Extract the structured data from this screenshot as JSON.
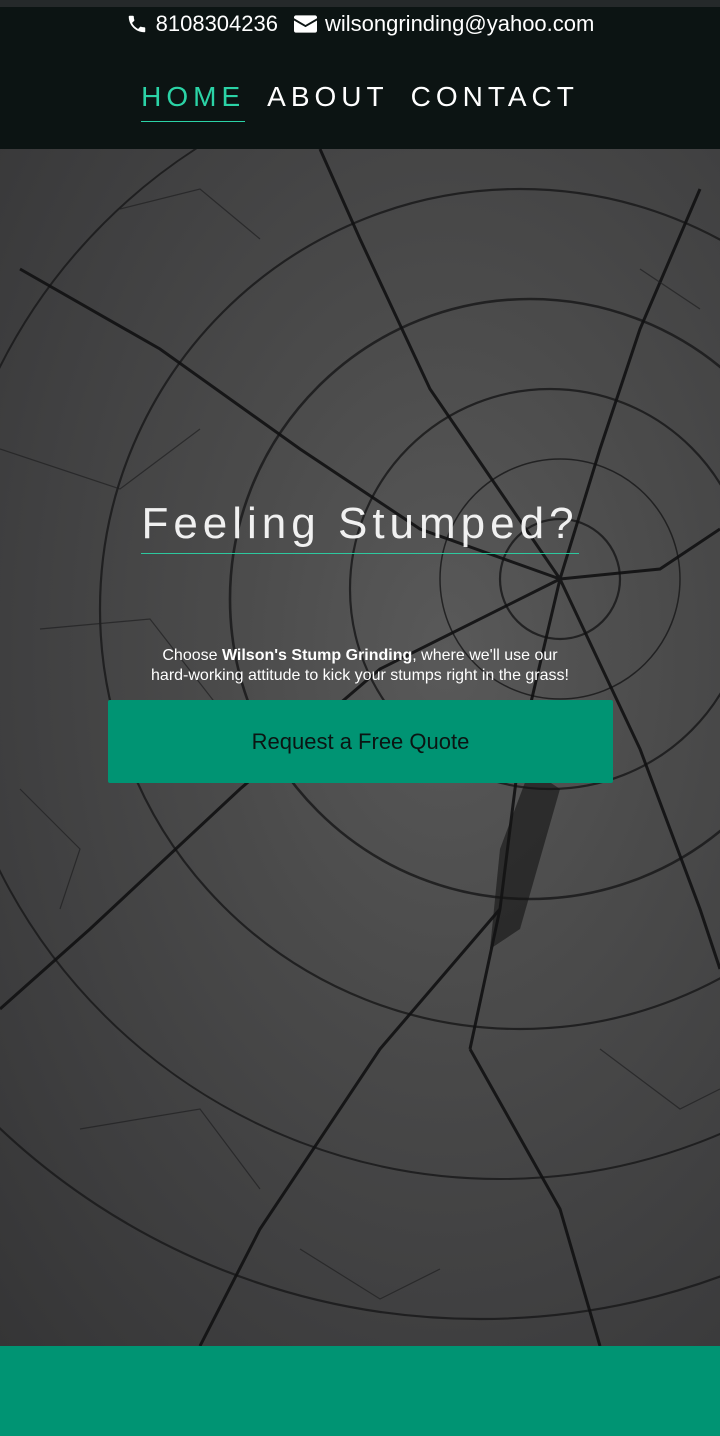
{
  "header": {
    "phone": "8108304236",
    "email": "wilsongrinding@yahoo.com"
  },
  "nav": {
    "items": [
      {
        "label": "HOME"
      },
      {
        "label": "ABOUT"
      },
      {
        "label": "CONTACT"
      }
    ]
  },
  "hero": {
    "title": "Feeling Stumped?",
    "text_before": "Choose ",
    "text_bold": "Wilson's Stump Grinding",
    "text_after": ", where we'll use our hard-working attitude to kick your stumps right in the grass!",
    "cta_label": "Request a Free Quote"
  },
  "colors": {
    "accent": "#2bd3a6",
    "button": "#009473",
    "header_bg": "#0c1413"
  }
}
